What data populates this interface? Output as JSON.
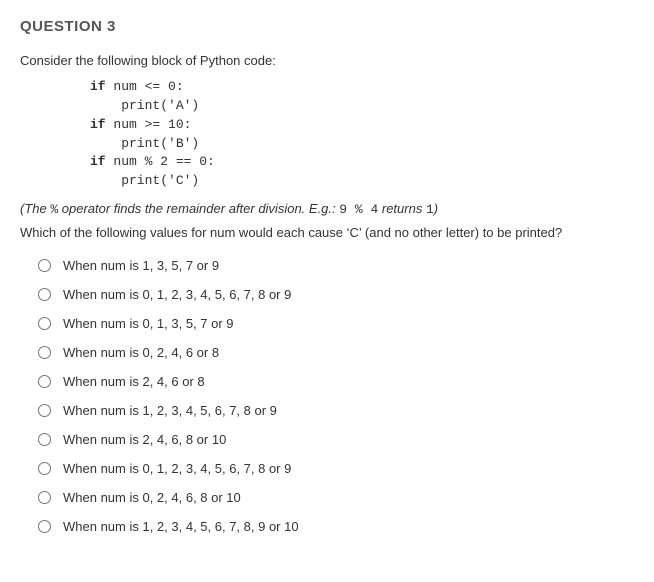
{
  "title": "QUESTION 3",
  "intro": "Consider the following block of Python code:",
  "code": {
    "l1a": "if",
    "l1b": " num <= 0:",
    "l2": "    print('A')",
    "l3a": "if",
    "l3b": " num >= 10:",
    "l4": "    print('B')",
    "l5a": "if",
    "l5b": " num % 2 == 0:",
    "l6": "    print('C')"
  },
  "note_parts": {
    "open": "(The ",
    "op": "%",
    "mid": " operator finds the remainder after division. E.g.: ",
    "expr": "9 % 4",
    "after": " returns ",
    "res": "1",
    "close": ")"
  },
  "prompt": "Which of the following values for num would each cause ‘C’ (and no other letter) to be printed?",
  "options": [
    "When num is 1, 3, 5, 7 or 9",
    "When num is 0, 1, 2, 3, 4, 5, 6, 7, 8 or 9",
    "When num is 0, 1, 3, 5, 7 or 9",
    "When num is 0, 2, 4, 6 or 8",
    "When num is 2, 4, 6 or 8",
    "When num is 1, 2, 3, 4, 5, 6, 7, 8 or 9",
    "When num is 2, 4, 6, 8 or 10",
    "When num is 0, 1, 2, 3, 4, 5, 6, 7, 8 or 9",
    "When num is 0, 2, 4, 6, 8 or 10",
    "When num is 1, 2, 3, 4, 5, 6, 7, 8, 9 or 10"
  ]
}
